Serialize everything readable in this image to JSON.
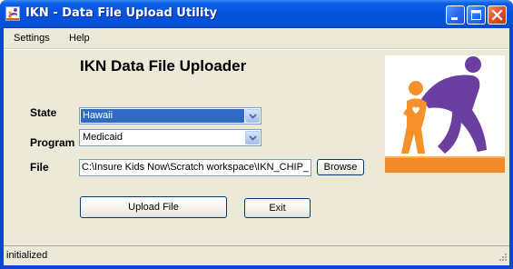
{
  "window": {
    "title": "IKN - Data File Upload Utility"
  },
  "menu": [
    "Settings",
    "Help"
  ],
  "form": {
    "heading": "IKN Data File Uploader",
    "state_label": "State",
    "state_value": "Hawaii",
    "program_label": "Program",
    "program_value": "Medicaid",
    "file_label": "File",
    "file_value": "C:\\Insure Kids Now\\Scratch workspace\\IKN_CHIP_",
    "browse_label": "Browse",
    "upload_label": "Upload File",
    "exit_label": "Exit"
  },
  "status": {
    "text": "initialized"
  },
  "colors": {
    "titlebar": "#0553dd",
    "client_bg": "#ece9d8",
    "selection": "#316ac5",
    "logo_orange": "#f5902a",
    "logo_purple": "#6b3fa0"
  },
  "icons": {
    "app": "app-icon",
    "minimize": "minimize-icon",
    "maximize": "maximize-icon",
    "close": "close-icon",
    "dropdown": "chevron-down-icon",
    "grip": "resize-grip-icon"
  }
}
